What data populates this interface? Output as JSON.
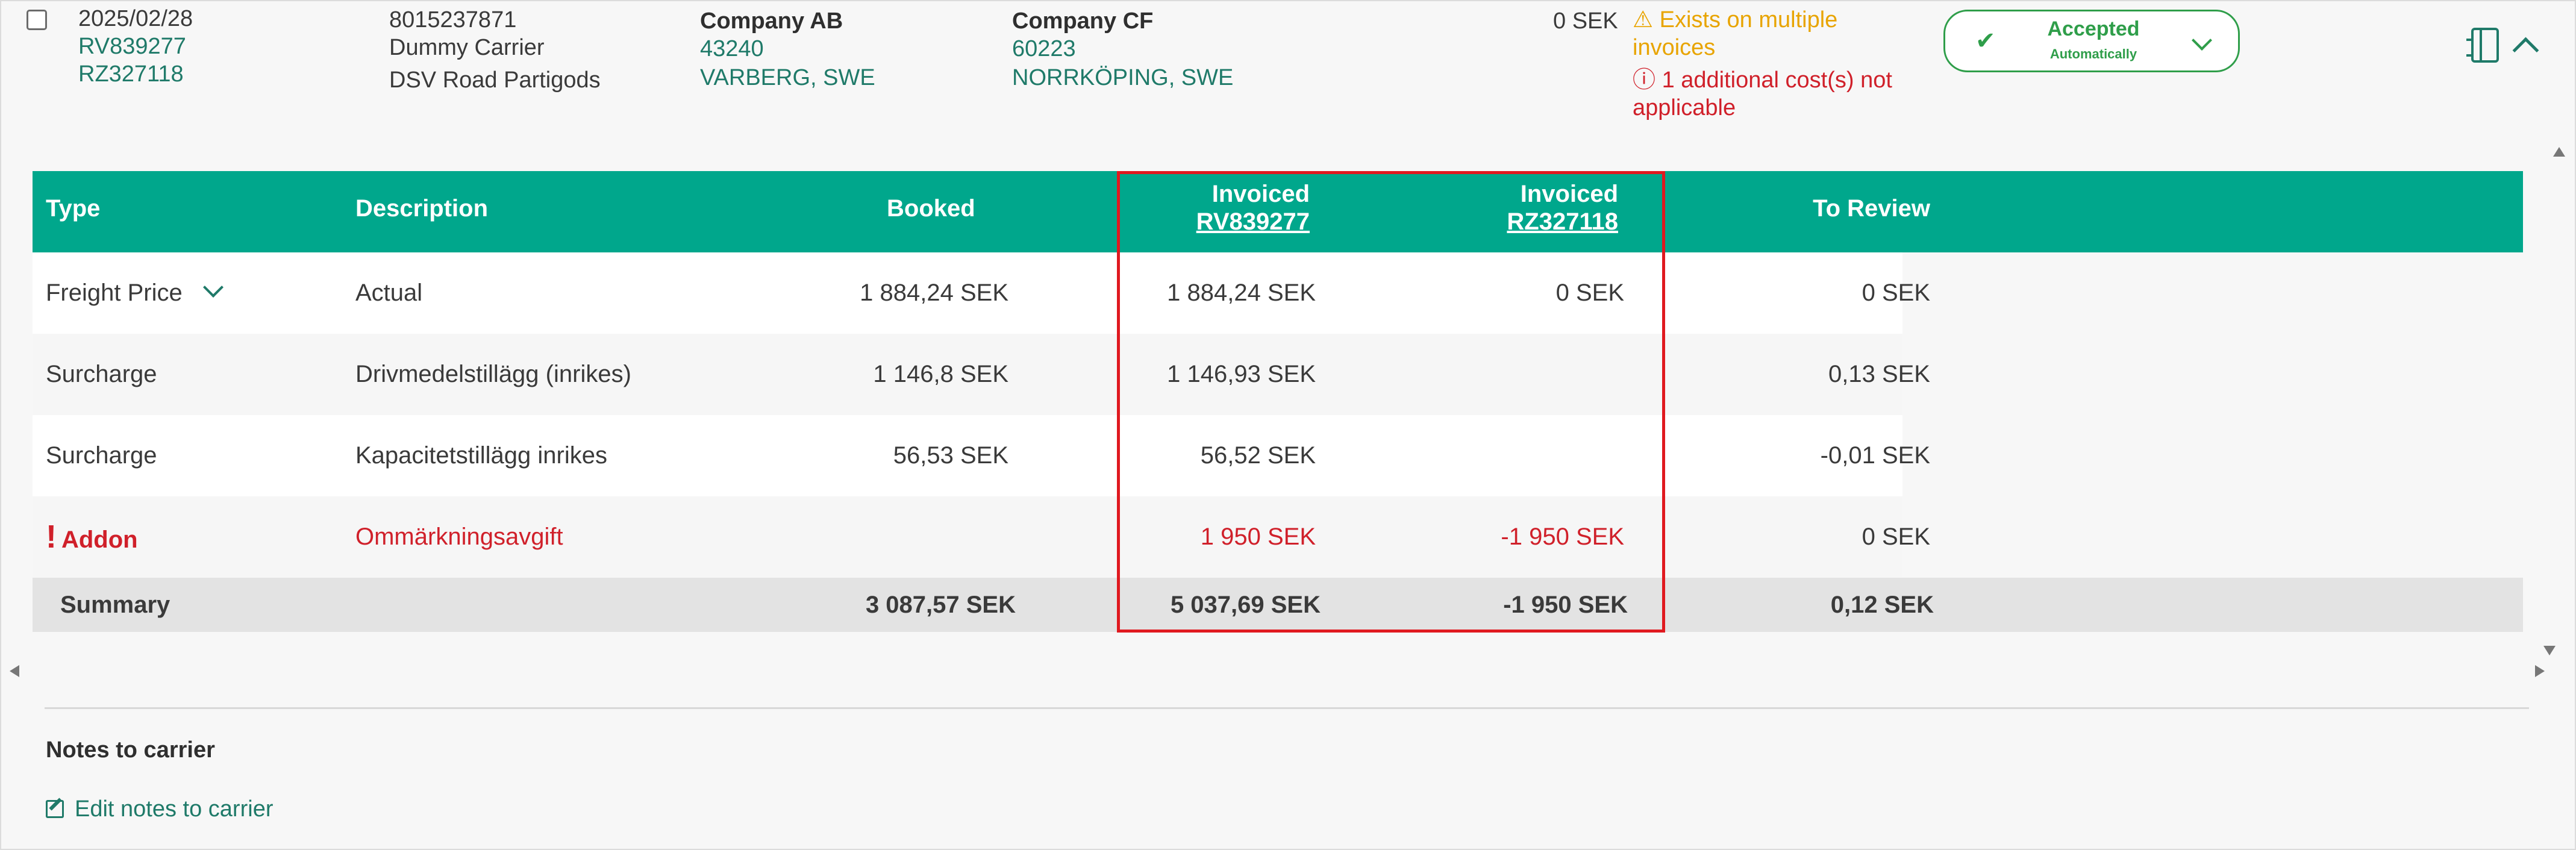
{
  "shipment": {
    "date": "2025/02/28",
    "invoice_ref_1": "RV839277",
    "invoice_ref_2": "RZ327118",
    "carrier_number": "8015237871",
    "carrier_name": "Dummy Carrier",
    "service": "DSV Road Partigods",
    "sender_name": "Company AB",
    "sender_zip": "43240",
    "sender_city": "VARBERG, SWE",
    "receiver_name": "Company CF",
    "receiver_zip": "60223",
    "receiver_city": "NORRKÖPING, SWE",
    "amount": "0 SEK",
    "warning_line1": "Exists on multiple",
    "warning_line2": "invoices",
    "error_line1": "1 additional cost(s) not",
    "error_line2": "applicable"
  },
  "status": {
    "label": "Accepted",
    "sublabel": "Automatically",
    "color": "#2f9e4a"
  },
  "table": {
    "headers": {
      "type": "Type",
      "description": "Description",
      "booked": "Booked",
      "invoiced_1": "Invoiced",
      "invoiced_1_ref": "RV839277",
      "invoiced_2": "Invoiced",
      "invoiced_2_ref": "RZ327118",
      "to_review": "To Review"
    },
    "header_color": "#00a78c",
    "rows": [
      {
        "type": "Freight Price",
        "description": "Actual",
        "booked": "1 884,24 SEK",
        "inv1": "1 884,24 SEK",
        "inv2": "0 SEK",
        "review": "0 SEK"
      },
      {
        "type": "Surcharge",
        "description": "Drivmedelstillägg (inrikes)",
        "booked": "1 146,8 SEK",
        "inv1": "1 146,93 SEK",
        "inv2": "",
        "review": "0,13 SEK"
      },
      {
        "type": "Surcharge",
        "description": "Kapacitetstillägg inrikes",
        "booked": "56,53 SEK",
        "inv1": "56,52 SEK",
        "inv2": "",
        "review": "-0,01 SEK"
      },
      {
        "type": "Addon",
        "description": "Ommärkningsavgift",
        "booked": "",
        "inv1": "1 950 SEK",
        "inv2": "-1 950 SEK",
        "review": "0 SEK"
      }
    ],
    "summary": {
      "label": "Summary",
      "booked": "3 087,57 SEK",
      "inv1": "5 037,69 SEK",
      "inv2": "-1 950 SEK",
      "review": "0,12 SEK"
    }
  },
  "notes": {
    "title": "Notes to carrier",
    "edit_link": "Edit notes to carrier"
  }
}
